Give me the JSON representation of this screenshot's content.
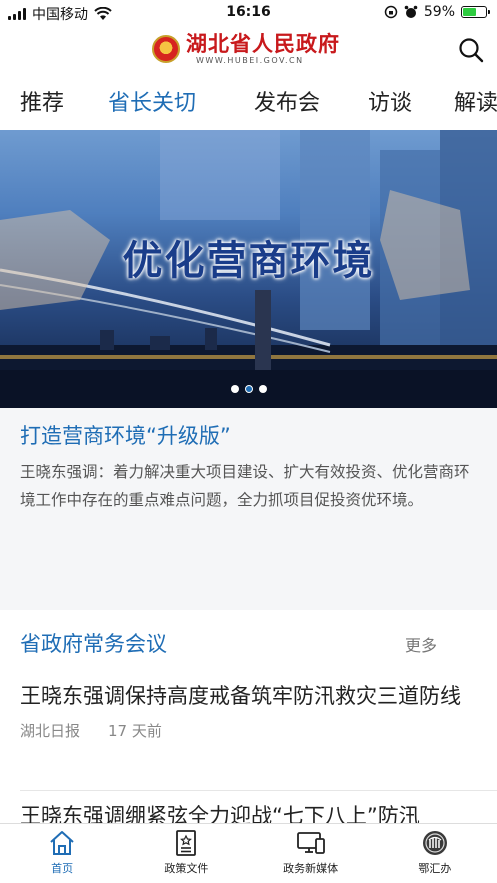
{
  "status_bar": {
    "carrier": "中国移动",
    "time": "16:16",
    "battery": "59%",
    "battery_level": 0.59,
    "icons": [
      "signal-icon",
      "wifi-icon",
      "orientation-lock-icon",
      "alarm-icon",
      "battery-icon"
    ]
  },
  "header": {
    "logo_text": "湖北省人民政府",
    "logo_url": "WWW.HUBEI.GOV.CN",
    "search_icon": "search-icon"
  },
  "tabs": [
    {
      "label": "推荐",
      "active": false
    },
    {
      "label": "省长关切",
      "active": true
    },
    {
      "label": "发布会",
      "active": false
    },
    {
      "label": "访谈",
      "active": false
    },
    {
      "label": "解读",
      "active": false
    }
  ],
  "banner": {
    "title": "优化营商环境",
    "slide_count": 3,
    "active_slide": 2
  },
  "feature": {
    "title": "打造营商环境“升级版”",
    "summary": "王晓东强调：着力解决重大项目建设、扩大有效投资、优化营商环境工作中存在的重点难点问题，全力抓项目促投资优环境。"
  },
  "section": {
    "title": "省政府常务会议",
    "more": "更多"
  },
  "news": [
    {
      "title": "王晓东强调保持高度戒备筑牢防汛救灾三道防线",
      "source": "湖北日报",
      "time": "17 天前"
    },
    {
      "title": "王晓东强调绷紧弦全力迎战“七下八上”防汛",
      "source": "",
      "time": ""
    }
  ],
  "tabbar": [
    {
      "label": "首页",
      "icon": "home-icon",
      "active": true
    },
    {
      "label": "政策文件",
      "icon": "policy-document-icon",
      "active": false
    },
    {
      "label": "政务新媒体",
      "icon": "devices-icon",
      "active": false
    },
    {
      "label": "鄂汇办",
      "icon": "ehuiban-logo-icon",
      "active": false
    }
  ],
  "colors": {
    "accent": "#1f6db5",
    "brand_red": "#c8191c",
    "feature_bg": "#f5f6f8"
  }
}
